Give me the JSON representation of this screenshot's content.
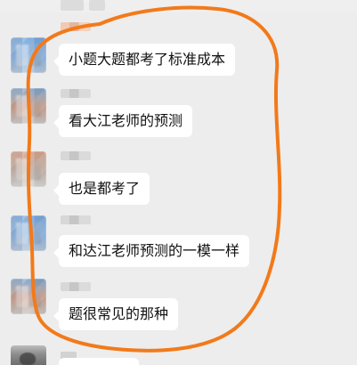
{
  "messages": [
    {
      "text": "小题大题都考了标准成本"
    },
    {
      "text": "看大江老师的预测"
    },
    {
      "text": "也是都考了"
    },
    {
      "text": "和达江老师预测的一模一样"
    },
    {
      "text": "题很常见的那种"
    }
  ],
  "colors": {
    "background": "#ededed",
    "bubble": "#ffffff",
    "text": "#111111",
    "annotation": "#f27a1a"
  },
  "icons": {
    "avatar": "avatar",
    "annotation": "orange-loop"
  }
}
